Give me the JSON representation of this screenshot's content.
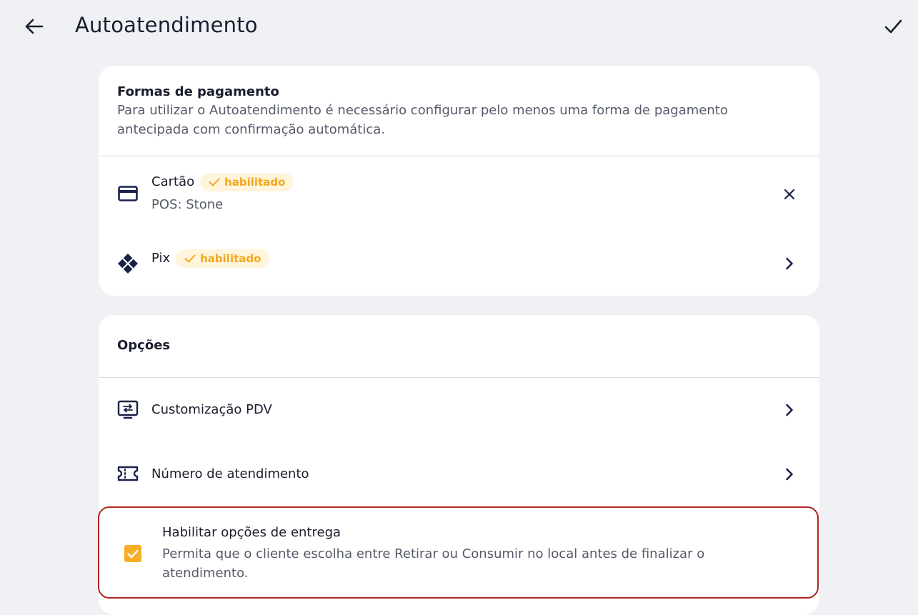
{
  "header": {
    "title": "Autoatendimento"
  },
  "payment": {
    "title": "Formas de pagamento",
    "subtitle": "Para utilizar o Autoatendimento é necessário configurar pelo menos uma forma de pagamento antecipada com confirmação automática.",
    "methods": [
      {
        "label": "Cartão",
        "badge": "habilitado",
        "detail": "POS: Stone",
        "icon": "credit-card-icon",
        "action": "close-icon"
      },
      {
        "label": "Pix",
        "badge": "habilitado",
        "icon": "pix-icon",
        "action": "chevron-right-icon"
      }
    ]
  },
  "options": {
    "title": "Opções",
    "items": [
      {
        "label": "Customização PDV",
        "icon": "pos-terminal-icon"
      },
      {
        "label": "Número de atendimento",
        "icon": "ticket-icon"
      }
    ],
    "delivery": {
      "title": "Habilitar opções de entrega",
      "description": "Permita que o cliente escolha entre Retirar ou Consumir no local antes de finalizar o atendimento.",
      "checked": true
    }
  },
  "colors": {
    "background": "#f0f1f5",
    "card": "#ffffff",
    "text": "#1a1d2e",
    "muted": "#555a6a",
    "badge_bg": "#fff4dc",
    "badge_text": "#f2a81d",
    "checkbox": "#f8ae24",
    "highlight_border": "#b3251f"
  }
}
